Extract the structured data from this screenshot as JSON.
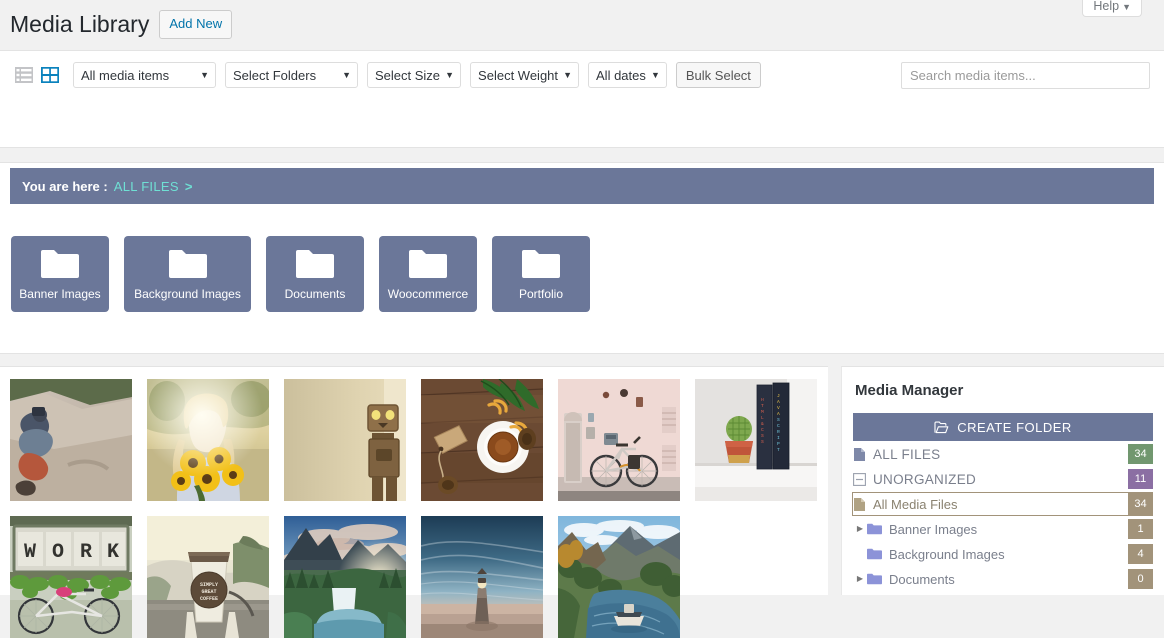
{
  "help": {
    "label": "Help",
    "caret": "▼",
    "icon": "chevron-down-icon"
  },
  "header": {
    "title": "Media Library",
    "add_new_label": "Add New"
  },
  "toolbar": {
    "list_view_icon": "list-view-icon",
    "grid_view_icon": "grid-view-icon",
    "caret": "▼",
    "selects": [
      {
        "name": "media-items-filter",
        "value": "All media items",
        "width": "wide"
      },
      {
        "name": "folders-filter",
        "value": "Select Folders",
        "width": "wide"
      },
      {
        "name": "size-filter",
        "value": "Select Size",
        "width": "auto"
      },
      {
        "name": "weight-filter",
        "value": "Select Weight",
        "width": "auto"
      },
      {
        "name": "dates-filter",
        "value": "All dates",
        "width": "auto"
      }
    ],
    "bulk_select_label": "Bulk Select",
    "search_placeholder": "Search media items..."
  },
  "breadcrumb": {
    "prefix": "You are here :",
    "current": "ALL FILES",
    "separator": ">"
  },
  "folders": [
    {
      "label": "Banner Images",
      "wide": false
    },
    {
      "label": "Background Images",
      "wide": true
    },
    {
      "label": "Documents",
      "wide": false
    },
    {
      "label": "Woocommerce",
      "wide": false
    },
    {
      "label": "Portfolio",
      "wide": false
    }
  ],
  "media_items": [
    {
      "name": "photographer-on-rocks",
      "alt": "Man with camera sitting on rocks"
    },
    {
      "name": "woman-with-sunflowers",
      "alt": "Blonde woman holding sunflowers at sunset"
    },
    {
      "name": "cardboard-robot",
      "alt": "Cardboard box robot figure against beige wall"
    },
    {
      "name": "tea-cup-flatlay",
      "alt": "Cup of tea with orange peel on wooden table"
    },
    {
      "name": "bicycle-pink-wall",
      "alt": "Bicycle parked against pink building wall"
    },
    {
      "name": "cactus-and-books",
      "alt": "Potted cactus next to HTML and JavaScript books"
    },
    {
      "name": "work-sign-bicycle",
      "alt": "WORK letter sign with plants and bicycle"
    },
    {
      "name": "coffee-cup-road",
      "alt": "Simply Great Coffee cup on car dashboard"
    },
    {
      "name": "mountain-waterfall-sunset",
      "alt": "Mountain waterfall with sunburst sky"
    },
    {
      "name": "lighthouse-dusk",
      "alt": "Lighthouse silhouette under dusk sky"
    },
    {
      "name": "river-valley-boat",
      "alt": "River valley with boat and green hills"
    }
  ],
  "media_manager": {
    "title": "Media Manager",
    "create_folder_label": "CREATE FOLDER",
    "create_folder_icon": "open-folder-icon",
    "tree": [
      {
        "name": "all-files",
        "label": "ALL FILES",
        "count": "34",
        "badge": "c-green",
        "icon": "file-icon",
        "arrow": "",
        "indent": 0,
        "selected": false,
        "caps": true
      },
      {
        "name": "unorganized",
        "label": "UNORGANIZED",
        "count": "11",
        "badge": "c-purple",
        "icon": "minus-box-icon",
        "arrow": "",
        "indent": 0,
        "selected": false,
        "caps": true
      },
      {
        "name": "all-media-files",
        "label": "All Media Files",
        "count": "34",
        "badge": "c-khaki",
        "icon": "file-khaki-icon",
        "arrow": "",
        "indent": 0,
        "selected": true,
        "caps": false
      },
      {
        "name": "banner-images",
        "label": "Banner Images",
        "count": "1",
        "badge": "c-khaki",
        "icon": "folder-icon",
        "arrow": "▶",
        "indent": 1,
        "selected": false,
        "caps": false
      },
      {
        "name": "background-images",
        "label": "Background Images",
        "count": "4",
        "badge": "c-khaki",
        "icon": "folder-icon",
        "arrow": "",
        "indent": 1,
        "selected": false,
        "caps": false
      },
      {
        "name": "documents",
        "label": "Documents",
        "count": "0",
        "badge": "c-khaki",
        "icon": "folder-icon",
        "arrow": "▶",
        "indent": 1,
        "selected": false,
        "caps": false
      }
    ]
  },
  "colors": {
    "slate": "#6b7799",
    "teal_link": "#6fe0d4",
    "badge_green": "#71976f",
    "badge_purple": "#8b6fa3",
    "badge_khaki": "#a2937a",
    "wp_blue": "#0073aa",
    "page_bg": "#f1f1f1"
  }
}
